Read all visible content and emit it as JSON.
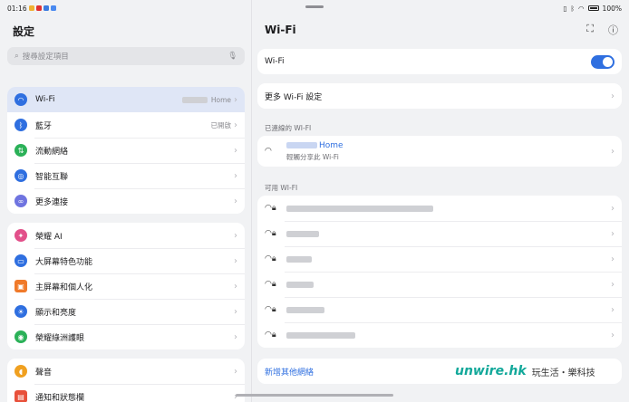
{
  "status": {
    "time": "01:16",
    "battery": "100%"
  },
  "left": {
    "title": "設定",
    "search_placeholder": "搜尋設定項目",
    "group1": [
      {
        "label": "Wi-Fi",
        "value": "Home",
        "icon": "wifi-icon",
        "color": "#2f6fe0"
      },
      {
        "label": "藍牙",
        "value": "已開啟",
        "icon": "bluetooth-icon",
        "color": "#2f6fe0"
      },
      {
        "label": "流動網絡",
        "value": "",
        "icon": "cellular-icon",
        "color": "#2bb158"
      },
      {
        "label": "智能互聯",
        "value": "",
        "icon": "smart-connect-icon",
        "color": "#2f6fe0"
      },
      {
        "label": "更多連接",
        "value": "",
        "icon": "link-icon",
        "color": "#6f74e0"
      }
    ],
    "group2": [
      {
        "label": "榮耀 AI",
        "icon": "ai-icon",
        "color": "#e2508a"
      },
      {
        "label": "大屏幕特色功能",
        "icon": "tablet-icon",
        "color": "#2f6fe0"
      },
      {
        "label": "主屏幕和個人化",
        "icon": "wallpaper-icon",
        "color": "#f07a2a"
      },
      {
        "label": "顯示和亮度",
        "icon": "brightness-icon",
        "color": "#2f6fe0"
      },
      {
        "label": "榮耀綠洲護眼",
        "icon": "eye-icon",
        "color": "#2bb158"
      }
    ],
    "group3": [
      {
        "label": "聲音",
        "icon": "sound-icon",
        "color": "#f0a020"
      },
      {
        "label": "通知和狀態欄",
        "icon": "notification-icon",
        "color": "#e8503a"
      }
    ]
  },
  "right": {
    "title": "Wi-Fi",
    "wifi_label": "Wi-Fi",
    "more_label": "更多 Wi-Fi 設定",
    "connected_header": "已連線的 WI-FI",
    "connected_name": "Home",
    "connected_sub": "輕觸分享此 Wi-Fi",
    "available_header": "可用 WI-FI",
    "add_network": "新增其他網絡"
  },
  "watermark": {
    "logo_a": "unwire",
    "logo_b": ".hk",
    "slogan": "玩生活・樂科技"
  }
}
